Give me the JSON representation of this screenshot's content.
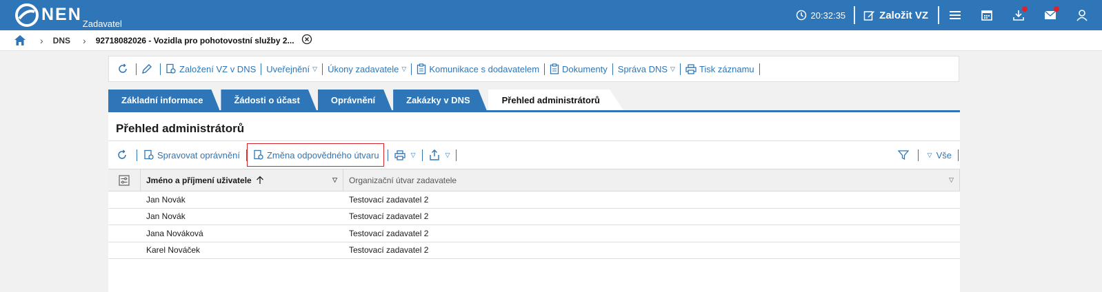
{
  "header": {
    "logo_text": "NEN",
    "logo_sub": "Zadavatel",
    "time": "20:32:35",
    "create_label": "Založit VZ",
    "icons": [
      "clock-icon",
      "edit-icon",
      "menu-icon",
      "calendar-icon",
      "download-icon",
      "mail-icon",
      "user-icon"
    ],
    "badge_color": "#e0232b"
  },
  "breadcrumb": {
    "items": [
      "DNS",
      "92718082026 - Vozidla pro pohotovostní služby 2..."
    ]
  },
  "actions": {
    "zalozeni": "Založení VZ v DNS",
    "uverejneni": "Uveřejnění",
    "ukony": "Úkony zadavatele",
    "komunikace": "Komunikace s dodavatelem",
    "dokumenty": "Dokumenty",
    "sprava": "Správa DNS",
    "tisk": "Tisk záznamu"
  },
  "tabs": [
    "Základní informace",
    "Žádosti o účast",
    "Oprávnění",
    "Zakázky v DNS",
    "Přehled administrátorů"
  ],
  "panel": {
    "title": "Přehled administrátorů",
    "spravovat": "Spravovat oprávnění",
    "zmena": "Změna odpovědného útvaru",
    "filter_all": "Vše"
  },
  "table": {
    "columns": [
      "Jméno a příjmení uživatele",
      "Organizační útvar zadavatele"
    ],
    "rows": [
      {
        "name": "Jan Novák",
        "org": "Testovací zadavatel 2"
      },
      {
        "name": "Jan Novák",
        "org": "Testovací zadavatel 2"
      },
      {
        "name": "Jana Nováková",
        "org": "Testovací zadavatel 2"
      },
      {
        "name": "Karel Nováček",
        "org": "Testovací zadavatel 2"
      }
    ]
  },
  "colors": {
    "brand": "#2e76b7",
    "highlight": "#d9232d"
  }
}
